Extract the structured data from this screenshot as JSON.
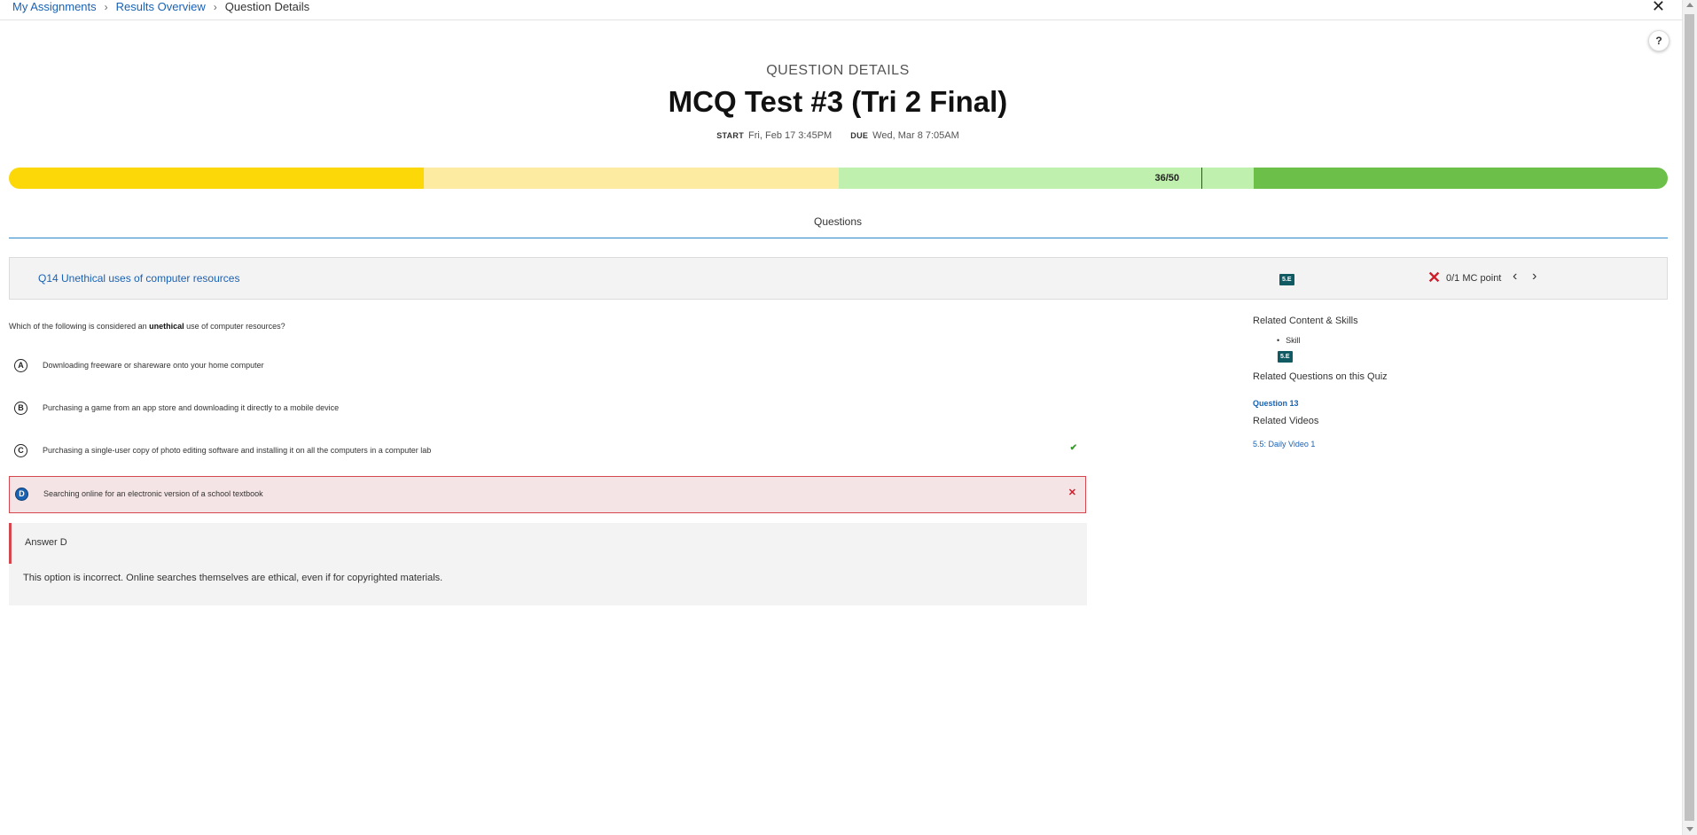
{
  "breadcrumb": {
    "items": [
      "My Assignments",
      "Results Overview"
    ],
    "current": "Question Details",
    "separator": "›"
  },
  "window": {
    "close_glyph": "✕",
    "help_glyph": "?"
  },
  "header": {
    "eyebrow": "QUESTION DETAILS",
    "title": "MCQ Test #3 (Tri 2 Final)",
    "start_label": "START",
    "start_value": "Fri, Feb 17 3:45PM",
    "due_label": "DUE",
    "due_value": "Wed, Mar 8 7:05AM"
  },
  "score_bar": {
    "score_text": "36/50",
    "score": 36,
    "max": 50,
    "colors": [
      "#fcd808",
      "#fdeba1",
      "#c0f0ae",
      "#6cc04a"
    ]
  },
  "tabs": {
    "questions": "Questions"
  },
  "question": {
    "title": "Q14 Unethical uses of computer resources",
    "skill_badge": "5.E",
    "score_icon": "✕",
    "score_text": "0/1 MC point",
    "prev_glyph": "‹",
    "next_glyph": "›",
    "stem_before": "Which of the following is considered an ",
    "stem_bold": "unethical",
    "stem_after": " use of computer resources?",
    "options": [
      {
        "letter": "A",
        "text": "Downloading freeware or shareware onto your home computer"
      },
      {
        "letter": "B",
        "text": "Purchasing a game from an app store and downloading it directly to a mobile device"
      },
      {
        "letter": "C",
        "text": "Purchasing a single-user copy of photo editing software and installing it on all the computers in a computer lab",
        "mark": "✔"
      },
      {
        "letter": "D",
        "text": "Searching online for an electronic version of a school textbook",
        "mark": "✕"
      }
    ],
    "explanation_title": "Answer D",
    "explanation_text": "This option is incorrect. Online searches themselves are ethical, even if for copyrighted materials."
  },
  "sidebar": {
    "related_content_heading": "Related Content & Skills",
    "skill_label": "Skill",
    "skill_badge": "5.E",
    "related_questions_heading": "Related Questions on this Quiz",
    "related_question_link": "Question 13",
    "related_videos_heading": "Related Videos",
    "video_link": "5.5: Daily Video 1"
  },
  "colors": {
    "link": "#1a62b3",
    "badge": "#0f5a63",
    "incorrect": "#cc1f2b",
    "correct": "#3a9a2e",
    "tab_underline": "#2a86c9"
  }
}
